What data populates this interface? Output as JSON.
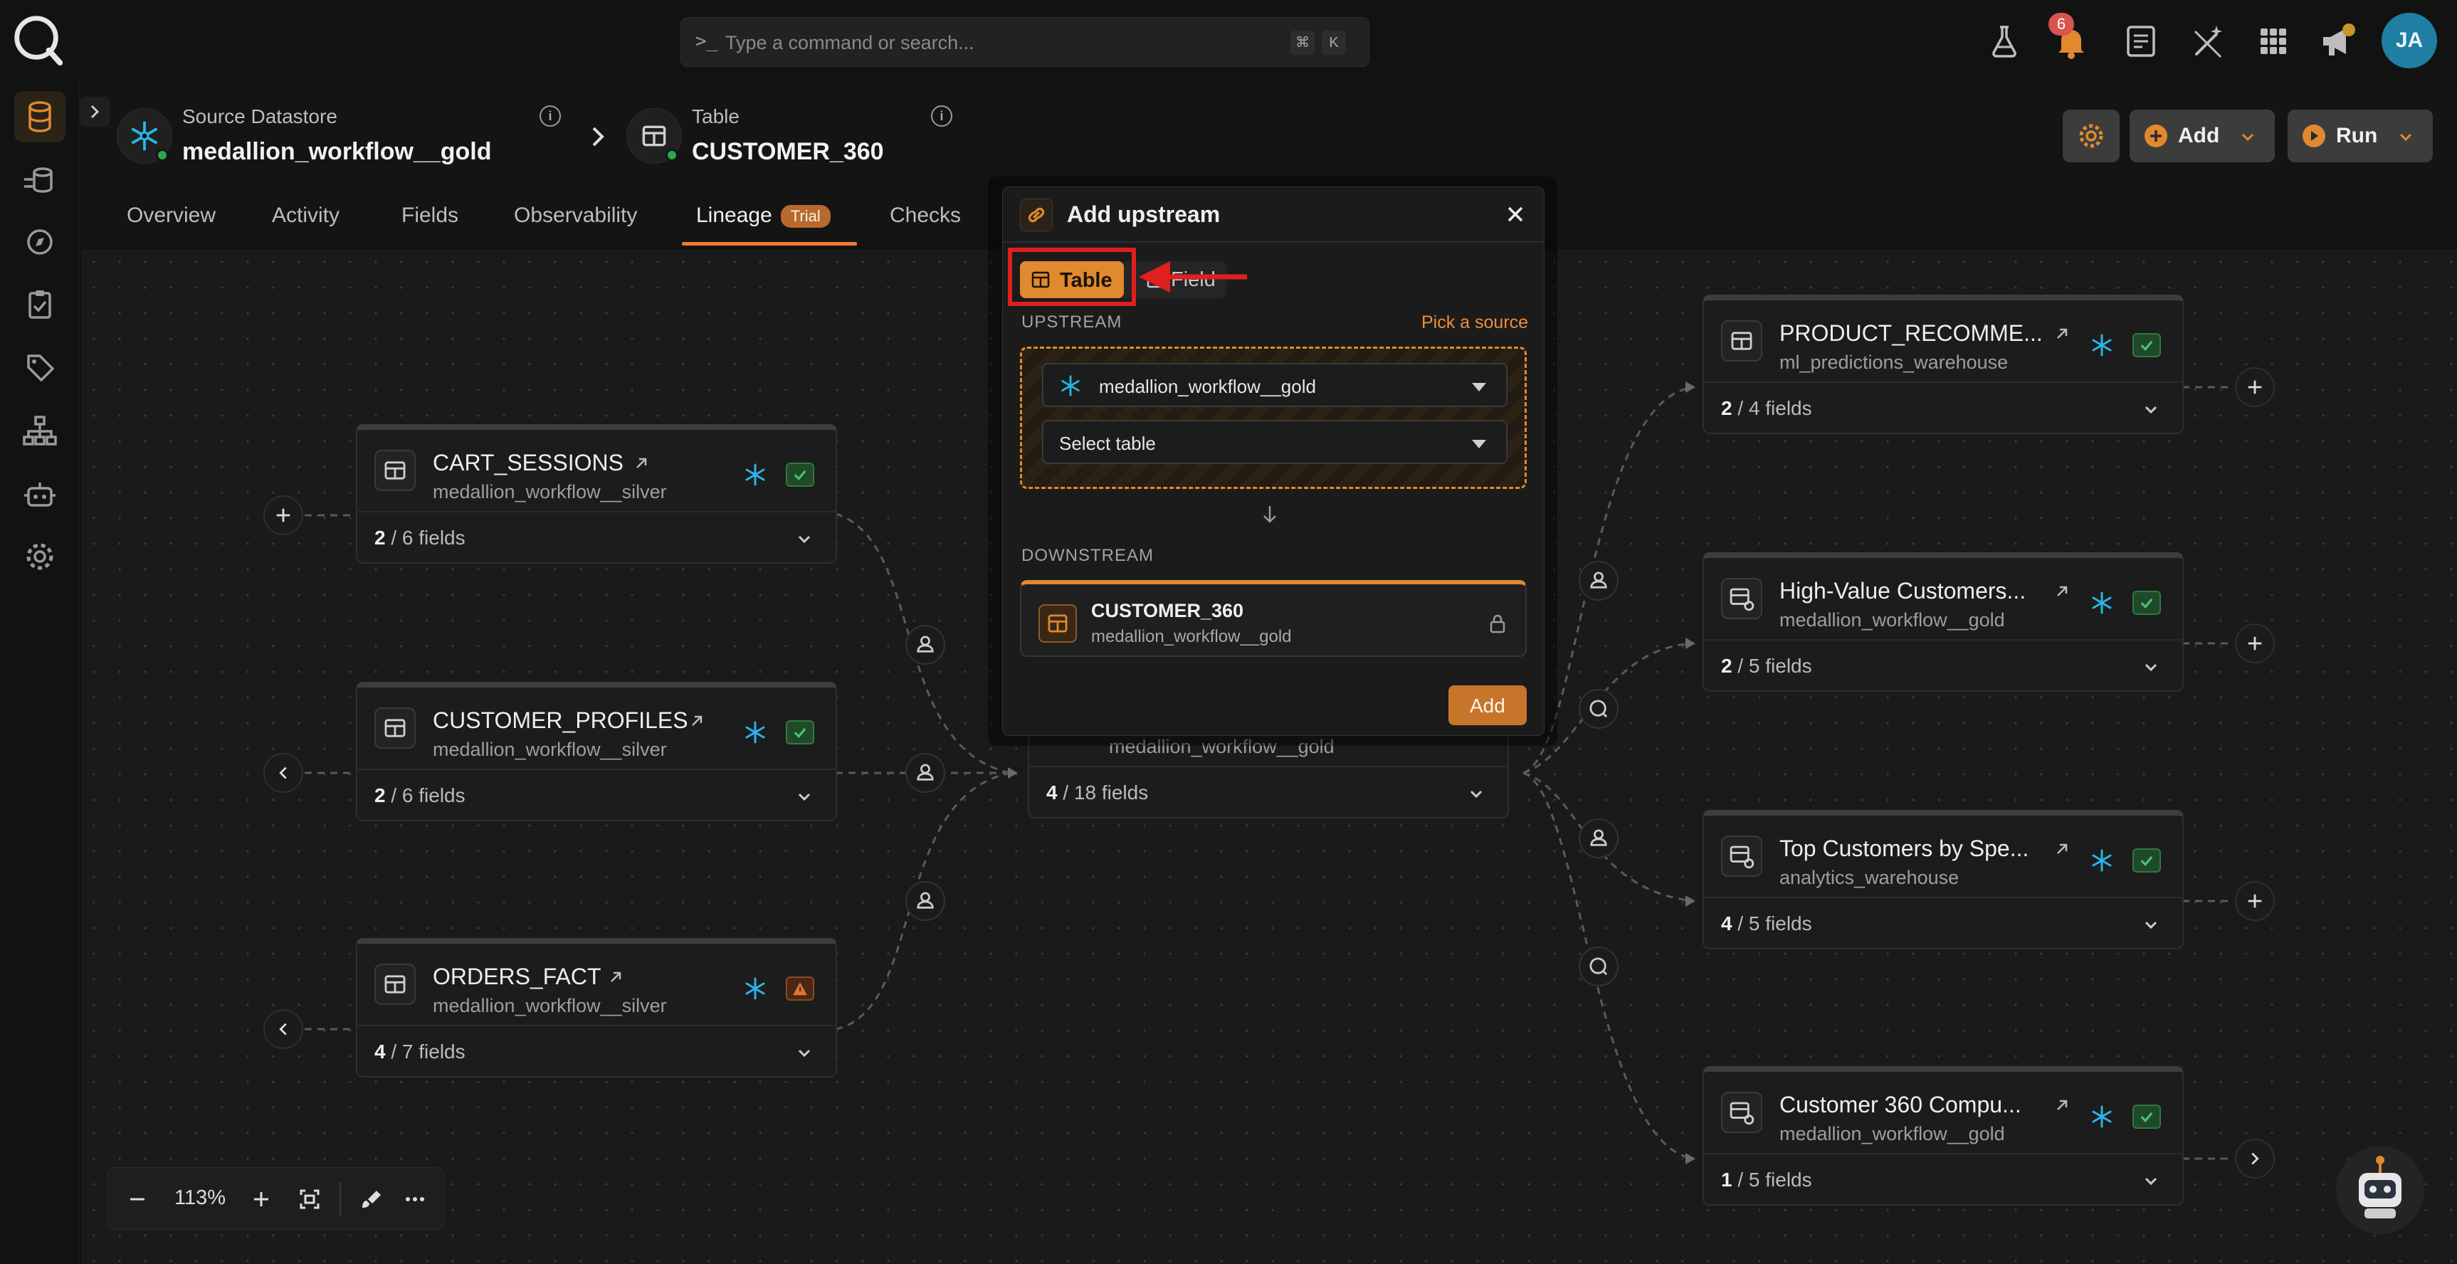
{
  "topbar": {
    "search_placeholder": "Type a command or search...",
    "shortcut_cmd": "⌘",
    "shortcut_key": "K",
    "notification_count": "6",
    "avatar_initials": "JA"
  },
  "header": {
    "datastore_label": "Source Datastore",
    "datastore_name": "medallion_workflow__gold",
    "table_label": "Table",
    "table_name": "CUSTOMER_360",
    "info": "i",
    "tabs": [
      {
        "label": "Overview"
      },
      {
        "label": "Activity"
      },
      {
        "label": "Fields"
      },
      {
        "label": "Observability"
      },
      {
        "label": "Lineage",
        "badge": "Trial"
      },
      {
        "label": "Checks"
      }
    ],
    "add_label": "Add",
    "run_label": "Run"
  },
  "nodes": {
    "left": [
      {
        "title": "CART_SESSIONS",
        "sub": "medallion_workflow__silver",
        "fields_sel": "2",
        "fields_rest": " / 6 fields",
        "status": "ok"
      },
      {
        "title": "CUSTOMER_PROFILES",
        "sub": "medallion_workflow__silver",
        "fields_sel": "2",
        "fields_rest": " / 6 fields",
        "status": "ok"
      },
      {
        "title": "ORDERS_FACT",
        "sub": "medallion_workflow__silver",
        "fields_sel": "4",
        "fields_rest": " / 7 fields",
        "status": "warning"
      }
    ],
    "center": {
      "sub": "medallion_workflow__gold",
      "fields_sel": "4",
      "fields_rest": " / 18 fields"
    },
    "right": [
      {
        "title": "PRODUCT_RECOMME...",
        "sub": "ml_predictions_warehouse",
        "fields_sel": "2",
        "fields_rest": " / 4 fields"
      },
      {
        "title": "High-Value Customers...",
        "sub": "medallion_workflow__gold",
        "fields_sel": "2",
        "fields_rest": " / 5 fields"
      },
      {
        "title": "Top Customers by Spe...",
        "sub": "analytics_warehouse",
        "fields_sel": "4",
        "fields_rest": " / 5 fields"
      },
      {
        "title": "Customer 360 Compu...",
        "sub": "medallion_workflow__gold",
        "fields_sel": "1",
        "fields_rest": " / 5 fields"
      }
    ]
  },
  "zoom": {
    "value": "113%"
  },
  "modal": {
    "title": "Add upstream",
    "toggle_table": "Table",
    "toggle_field": "Field",
    "upstream_label": "UPSTREAM",
    "pick_source": "Pick a source",
    "datastore_value": "medallion_workflow__gold",
    "table_placeholder": "Select table",
    "downstream_label": "DOWNSTREAM",
    "downstream_name": "CUSTOMER_360",
    "downstream_sub": "medallion_workflow__gold",
    "add_label": "Add"
  },
  "colors": {
    "accent": "#e0892e",
    "highlight": "#e01f1f",
    "ok": "#2f7a3e",
    "warn": "#e0772e",
    "snowflake": "#29b5e8"
  }
}
